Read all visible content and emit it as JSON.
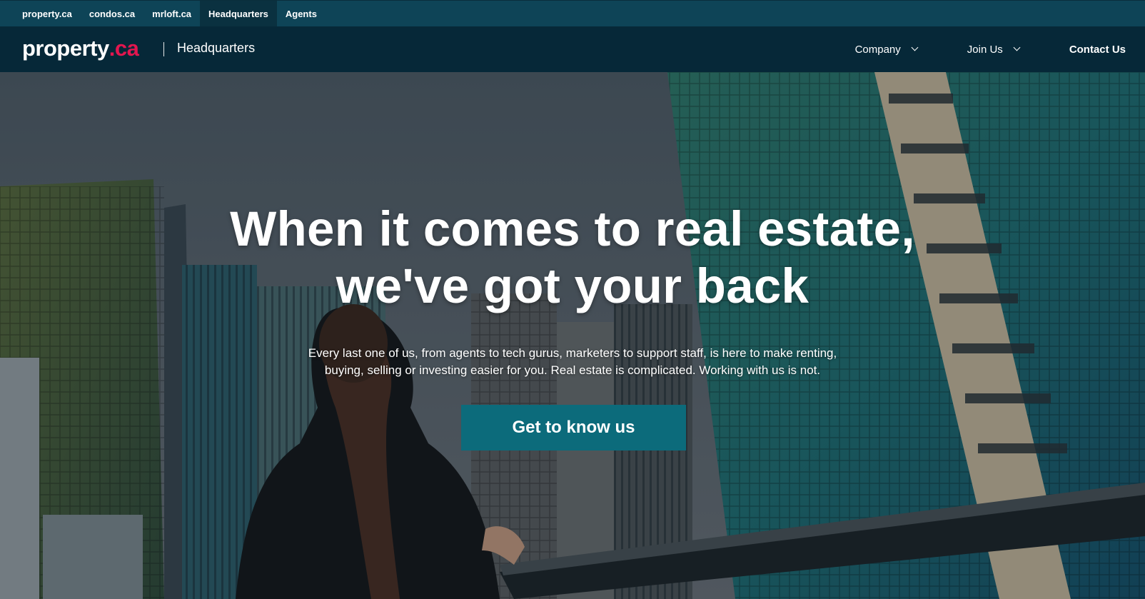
{
  "topbar": {
    "links": [
      {
        "label": "property.ca"
      },
      {
        "label": "condos.ca"
      },
      {
        "label": "mrloft.ca"
      },
      {
        "label": "Headquarters",
        "active": true
      },
      {
        "label": "Agents"
      }
    ]
  },
  "header": {
    "logo_word": "property",
    "logo_suffix": ".ca",
    "section": "Headquarters",
    "nav": {
      "company": "Company",
      "join": "Join Us",
      "contact": "Contact Us"
    }
  },
  "hero": {
    "headline_line1": "When it comes to real estate,",
    "headline_line2": "we've got your back",
    "subtext_line1": "Every last one of us, from agents to tech gurus, marketers to support staff, is here to make renting,",
    "subtext_line2": "buying, selling or investing easier for you. Real estate is complicated. Working with us is not.",
    "cta_label": "Get to know us"
  },
  "colors": {
    "topbar_bg": "#0e4457",
    "nav_bg": "#062838",
    "logo_accent": "#e3164f",
    "cta_bg": "#0c6b7b"
  }
}
